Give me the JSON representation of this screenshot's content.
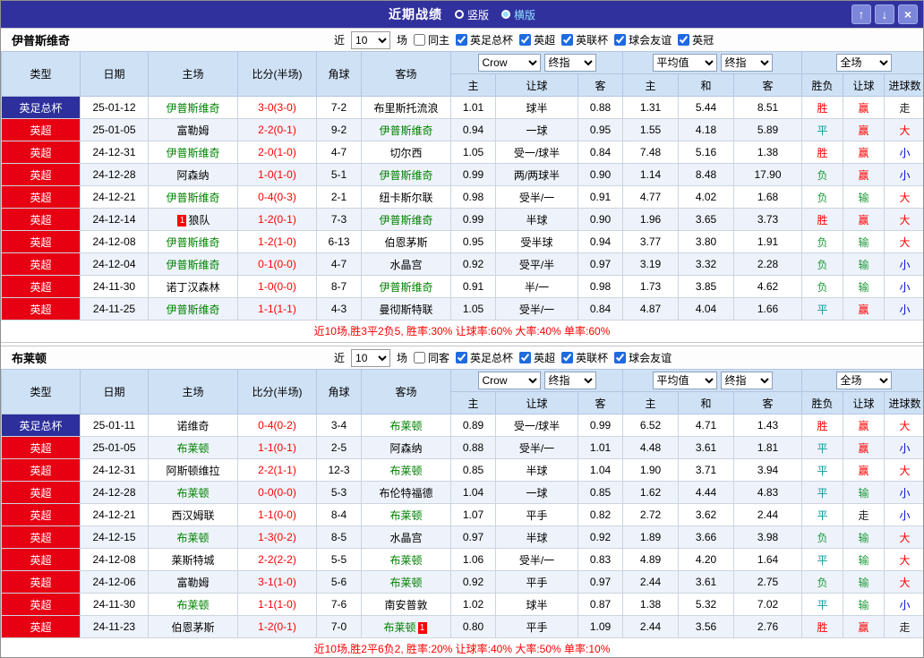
{
  "titlebar": {
    "title": "近期战绩",
    "vertical": "竖版",
    "horizontal": "横版",
    "up": "↑",
    "down": "↓",
    "close": "×"
  },
  "labels": {
    "near": "近",
    "games": "场"
  },
  "columns": {
    "type": "类型",
    "date": "日期",
    "home": "主场",
    "score": "比分(半场)",
    "corner": "角球",
    "away": "客场",
    "h": "主",
    "hcap": "让球",
    "a": "客",
    "avg_h": "主",
    "avg_d": "和",
    "avg_a": "客",
    "wdl": "胜负",
    "hcap_r": "让球",
    "goals": "进球数"
  },
  "selects": {
    "book": "Crow",
    "final1": "终指",
    "avg": "平均值",
    "final2": "终指",
    "scope": "全场"
  },
  "colors": {
    "accent_navy": "#31319e",
    "badge_cup": "#2d2f9c",
    "badge_epl": "#e60012",
    "self_team_green": "#008000",
    "score_red": "#ff0000",
    "header_blue": "#cfe1f5"
  },
  "tables": [
    {
      "team": "伊普斯维奇",
      "count": "10",
      "same": "同主",
      "leagues": [
        "英足总杯",
        "英超",
        "英联杯",
        "球会友谊",
        "英冠"
      ],
      "summary": "近10场,胜3平2负5, 胜率:30% 让球率:60% 大率:40% 单率:60%",
      "rows": [
        {
          "lg": "英足总杯",
          "lgc": "lg-cup",
          "date": "25-01-12",
          "home": "伊普斯维奇",
          "homec": "t-self",
          "hcard": "",
          "score": "3-0(3-0)",
          "corner": "7-2",
          "away": "布里斯托流浪",
          "awayc": "",
          "acard": "",
          "o1": "1.01",
          "o2": "球半",
          "o3": "0.88",
          "a1": "1.31",
          "a2": "5.44",
          "a3": "8.51",
          "r1": "胜",
          "r1c": "c-red",
          "r2": "赢",
          "r2c": "c-red",
          "r3": "走",
          "r3c": "c-dark"
        },
        {
          "lg": "英超",
          "lgc": "lg-epl",
          "date": "25-01-05",
          "home": "富勒姆",
          "homec": "",
          "hcard": "",
          "score": "2-2(0-1)",
          "corner": "9-2",
          "away": "伊普斯维奇",
          "awayc": "t-self",
          "acard": "",
          "o1": "0.94",
          "o2": "一球",
          "o3": "0.95",
          "a1": "1.55",
          "a2": "4.18",
          "a3": "5.89",
          "r1": "平",
          "r1c": "c-teal",
          "r2": "赢",
          "r2c": "c-red",
          "r3": "大",
          "r3c": "c-red"
        },
        {
          "lg": "英超",
          "lgc": "lg-epl",
          "date": "24-12-31",
          "home": "伊普斯维奇",
          "homec": "t-self",
          "hcard": "",
          "score": "2-0(1-0)",
          "corner": "4-7",
          "away": "切尔西",
          "awayc": "",
          "acard": "",
          "o1": "1.05",
          "o2": "受一/球半",
          "o3": "0.84",
          "a1": "7.48",
          "a2": "5.16",
          "a3": "1.38",
          "r1": "胜",
          "r1c": "c-red",
          "r2": "赢",
          "r2c": "c-red",
          "r3": "小",
          "r3c": "c-blue"
        },
        {
          "lg": "英超",
          "lgc": "lg-epl",
          "date": "24-12-28",
          "home": "阿森纳",
          "homec": "",
          "hcard": "",
          "score": "1-0(1-0)",
          "corner": "5-1",
          "away": "伊普斯维奇",
          "awayc": "t-self",
          "acard": "",
          "o1": "0.99",
          "o2": "两/两球半",
          "o3": "0.90",
          "a1": "1.14",
          "a2": "8.48",
          "a3": "17.90",
          "r1": "负",
          "r1c": "c-green",
          "r2": "赢",
          "r2c": "c-red",
          "r3": "小",
          "r3c": "c-blue"
        },
        {
          "lg": "英超",
          "lgc": "lg-epl",
          "date": "24-12-21",
          "home": "伊普斯维奇",
          "homec": "t-self",
          "hcard": "",
          "score": "0-4(0-3)",
          "corner": "2-1",
          "away": "纽卡斯尔联",
          "awayc": "",
          "acard": "",
          "o1": "0.98",
          "o2": "受半/一",
          "o3": "0.91",
          "a1": "4.77",
          "a2": "4.02",
          "a3": "1.68",
          "r1": "负",
          "r1c": "c-green",
          "r2": "输",
          "r2c": "c-green",
          "r3": "大",
          "r3c": "c-red"
        },
        {
          "lg": "英超",
          "lgc": "lg-epl",
          "date": "24-12-14",
          "home": "狼队",
          "homec": "",
          "hcard": "1",
          "score": "1-2(0-1)",
          "corner": "7-3",
          "away": "伊普斯维奇",
          "awayc": "t-self",
          "acard": "",
          "o1": "0.99",
          "o2": "半球",
          "o3": "0.90",
          "a1": "1.96",
          "a2": "3.65",
          "a3": "3.73",
          "r1": "胜",
          "r1c": "c-red",
          "r2": "赢",
          "r2c": "c-red",
          "r3": "大",
          "r3c": "c-red"
        },
        {
          "lg": "英超",
          "lgc": "lg-epl",
          "date": "24-12-08",
          "home": "伊普斯维奇",
          "homec": "t-self",
          "hcard": "",
          "score": "1-2(1-0)",
          "corner": "6-13",
          "away": "伯恩茅斯",
          "awayc": "",
          "acard": "",
          "o1": "0.95",
          "o2": "受半球",
          "o3": "0.94",
          "a1": "3.77",
          "a2": "3.80",
          "a3": "1.91",
          "r1": "负",
          "r1c": "c-green",
          "r2": "输",
          "r2c": "c-green",
          "r3": "大",
          "r3c": "c-red"
        },
        {
          "lg": "英超",
          "lgc": "lg-epl",
          "date": "24-12-04",
          "home": "伊普斯维奇",
          "homec": "t-self",
          "hcard": "",
          "score": "0-1(0-0)",
          "corner": "4-7",
          "away": "水晶宫",
          "awayc": "",
          "acard": "",
          "o1": "0.92",
          "o2": "受平/半",
          "o3": "0.97",
          "a1": "3.19",
          "a2": "3.32",
          "a3": "2.28",
          "r1": "负",
          "r1c": "c-green",
          "r2": "输",
          "r2c": "c-green",
          "r3": "小",
          "r3c": "c-blue"
        },
        {
          "lg": "英超",
          "lgc": "lg-epl",
          "date": "24-11-30",
          "home": "诺丁汉森林",
          "homec": "",
          "hcard": "",
          "score": "1-0(0-0)",
          "corner": "8-7",
          "away": "伊普斯维奇",
          "awayc": "t-self",
          "acard": "",
          "o1": "0.91",
          "o2": "半/一",
          "o3": "0.98",
          "a1": "1.73",
          "a2": "3.85",
          "a3": "4.62",
          "r1": "负",
          "r1c": "c-green",
          "r2": "输",
          "r2c": "c-green",
          "r3": "小",
          "r3c": "c-blue"
        },
        {
          "lg": "英超",
          "lgc": "lg-epl",
          "date": "24-11-25",
          "home": "伊普斯维奇",
          "homec": "t-self",
          "hcard": "",
          "score": "1-1(1-1)",
          "corner": "4-3",
          "away": "曼彻斯特联",
          "awayc": "",
          "acard": "",
          "o1": "1.05",
          "o2": "受半/一",
          "o3": "0.84",
          "a1": "4.87",
          "a2": "4.04",
          "a3": "1.66",
          "r1": "平",
          "r1c": "c-teal",
          "r2": "赢",
          "r2c": "c-red",
          "r3": "小",
          "r3c": "c-blue"
        }
      ]
    },
    {
      "team": "布莱顿",
      "count": "10",
      "same": "同客",
      "leagues": [
        "英足总杯",
        "英超",
        "英联杯",
        "球会友谊"
      ],
      "summary": "近10场,胜2平6负2, 胜率:20% 让球率:40% 大率:50% 单率:10%",
      "rows": [
        {
          "lg": "英足总杯",
          "lgc": "lg-cup",
          "date": "25-01-11",
          "home": "诺维奇",
          "homec": "",
          "hcard": "",
          "score": "0-4(0-2)",
          "corner": "3-4",
          "away": "布莱顿",
          "awayc": "t-self",
          "acard": "",
          "o1": "0.89",
          "o2": "受一/球半",
          "o3": "0.99",
          "a1": "6.52",
          "a2": "4.71",
          "a3": "1.43",
          "r1": "胜",
          "r1c": "c-red",
          "r2": "赢",
          "r2c": "c-red",
          "r3": "大",
          "r3c": "c-red"
        },
        {
          "lg": "英超",
          "lgc": "lg-epl",
          "date": "25-01-05",
          "home": "布莱顿",
          "homec": "t-self",
          "hcard": "",
          "score": "1-1(0-1)",
          "corner": "2-5",
          "away": "阿森纳",
          "awayc": "",
          "acard": "",
          "o1": "0.88",
          "o2": "受半/一",
          "o3": "1.01",
          "a1": "4.48",
          "a2": "3.61",
          "a3": "1.81",
          "r1": "平",
          "r1c": "c-teal",
          "r2": "赢",
          "r2c": "c-red",
          "r3": "小",
          "r3c": "c-blue"
        },
        {
          "lg": "英超",
          "lgc": "lg-epl",
          "date": "24-12-31",
          "home": "阿斯顿维拉",
          "homec": "",
          "hcard": "",
          "score": "2-2(1-1)",
          "corner": "12-3",
          "away": "布莱顿",
          "awayc": "t-self",
          "acard": "",
          "o1": "0.85",
          "o2": "半球",
          "o3": "1.04",
          "a1": "1.90",
          "a2": "3.71",
          "a3": "3.94",
          "r1": "平",
          "r1c": "c-teal",
          "r2": "赢",
          "r2c": "c-red",
          "r3": "大",
          "r3c": "c-red"
        },
        {
          "lg": "英超",
          "lgc": "lg-epl",
          "date": "24-12-28",
          "home": "布莱顿",
          "homec": "t-self",
          "hcard": "",
          "score": "0-0(0-0)",
          "corner": "5-3",
          "away": "布伦特福德",
          "awayc": "",
          "acard": "",
          "o1": "1.04",
          "o2": "一球",
          "o3": "0.85",
          "a1": "1.62",
          "a2": "4.44",
          "a3": "4.83",
          "r1": "平",
          "r1c": "c-teal",
          "r2": "输",
          "r2c": "c-green",
          "r3": "小",
          "r3c": "c-blue"
        },
        {
          "lg": "英超",
          "lgc": "lg-epl",
          "date": "24-12-21",
          "home": "西汉姆联",
          "homec": "",
          "hcard": "",
          "score": "1-1(0-0)",
          "corner": "8-4",
          "away": "布莱顿",
          "awayc": "t-self",
          "acard": "",
          "o1": "1.07",
          "o2": "平手",
          "o3": "0.82",
          "a1": "2.72",
          "a2": "3.62",
          "a3": "2.44",
          "r1": "平",
          "r1c": "c-teal",
          "r2": "走",
          "r2c": "c-dark",
          "r3": "小",
          "r3c": "c-blue"
        },
        {
          "lg": "英超",
          "lgc": "lg-epl",
          "date": "24-12-15",
          "home": "布莱顿",
          "homec": "t-self",
          "hcard": "",
          "score": "1-3(0-2)",
          "corner": "8-5",
          "away": "水晶宫",
          "awayc": "",
          "acard": "",
          "o1": "0.97",
          "o2": "半球",
          "o3": "0.92",
          "a1": "1.89",
          "a2": "3.66",
          "a3": "3.98",
          "r1": "负",
          "r1c": "c-green",
          "r2": "输",
          "r2c": "c-green",
          "r3": "大",
          "r3c": "c-red"
        },
        {
          "lg": "英超",
          "lgc": "lg-epl",
          "date": "24-12-08",
          "home": "莱斯特城",
          "homec": "",
          "hcard": "",
          "score": "2-2(2-2)",
          "corner": "5-5",
          "away": "布莱顿",
          "awayc": "t-self",
          "acard": "",
          "o1": "1.06",
          "o2": "受半/一",
          "o3": "0.83",
          "a1": "4.89",
          "a2": "4.20",
          "a3": "1.64",
          "r1": "平",
          "r1c": "c-teal",
          "r2": "输",
          "r2c": "c-green",
          "r3": "大",
          "r3c": "c-red"
        },
        {
          "lg": "英超",
          "lgc": "lg-epl",
          "date": "24-12-06",
          "home": "富勒姆",
          "homec": "",
          "hcard": "",
          "score": "3-1(1-0)",
          "corner": "5-6",
          "away": "布莱顿",
          "awayc": "t-self",
          "acard": "",
          "o1": "0.92",
          "o2": "平手",
          "o3": "0.97",
          "a1": "2.44",
          "a2": "3.61",
          "a3": "2.75",
          "r1": "负",
          "r1c": "c-green",
          "r2": "输",
          "r2c": "c-green",
          "r3": "大",
          "r3c": "c-red"
        },
        {
          "lg": "英超",
          "lgc": "lg-epl",
          "date": "24-11-30",
          "home": "布莱顿",
          "homec": "t-self",
          "hcard": "",
          "score": "1-1(1-0)",
          "corner": "7-6",
          "away": "南安普敦",
          "awayc": "",
          "acard": "",
          "o1": "1.02",
          "o2": "球半",
          "o3": "0.87",
          "a1": "1.38",
          "a2": "5.32",
          "a3": "7.02",
          "r1": "平",
          "r1c": "c-teal",
          "r2": "输",
          "r2c": "c-green",
          "r3": "小",
          "r3c": "c-blue"
        },
        {
          "lg": "英超",
          "lgc": "lg-epl",
          "date": "24-11-23",
          "home": "伯恩茅斯",
          "homec": "",
          "hcard": "",
          "score": "1-2(0-1)",
          "corner": "7-0",
          "away": "布莱顿",
          "awayc": "t-self",
          "acard": "1",
          "o1": "0.80",
          "o2": "平手",
          "o3": "1.09",
          "a1": "2.44",
          "a2": "3.56",
          "a3": "2.76",
          "r1": "胜",
          "r1c": "c-red",
          "r2": "赢",
          "r2c": "c-red",
          "r3": "走",
          "r3c": "c-dark"
        }
      ]
    }
  ]
}
